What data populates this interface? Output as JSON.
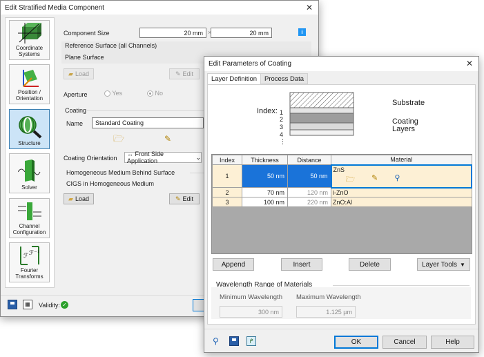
{
  "back_window": {
    "title": "Edit Stratified Media Component",
    "sidebar": [
      {
        "label": "Coordinate Systems"
      },
      {
        "label": "Position / Orientation"
      },
      {
        "label": "Structure"
      },
      {
        "label": "Solver"
      },
      {
        "label": "Channel Configuration"
      },
      {
        "label": "Fourier Transforms"
      }
    ],
    "component_size_label": "Component Size",
    "size_x": "20 mm",
    "size_times": "×",
    "size_y": "20 mm",
    "reference_surface_title": "Reference Surface (all Channels)",
    "reference_surface_value": "Plane Surface",
    "load_label": "Load",
    "edit_label": "Edit",
    "aperture_label": "Aperture",
    "aperture_yes": "Yes",
    "aperture_no": "No",
    "coating_title": "Coating",
    "name_label": "Name",
    "coating_name": "Standard Coating",
    "coating_orientation_label": "Coating Orientation",
    "coating_orientation_value": "↔ Front Side Application",
    "homogeneous_title": "Homogeneous Medium Behind Surface",
    "homogeneous_value": "CIGS in Homogeneous Medium",
    "load2_label": "Load",
    "edit2_label": "Edit",
    "validity_label": "Validity:",
    "info_icon_text": "i"
  },
  "front_window": {
    "title": "Edit Parameters of Coating",
    "tabs": [
      {
        "label": "Layer Definition"
      },
      {
        "label": "Process Data"
      }
    ],
    "diagram": {
      "index_label": "Index:",
      "indices": [
        "1",
        "2",
        "3",
        "4",
        "⋮"
      ],
      "substrate_label": "Substrate",
      "coating_layers_label": "Coating\nLayers"
    },
    "table": {
      "headers": [
        "Index",
        "Thickness",
        "Distance",
        "Material"
      ],
      "rows": [
        {
          "index": "1",
          "thickness": "50 nm",
          "distance": "50 nm",
          "material": "ZnS"
        },
        {
          "index": "2",
          "thickness": "70 nm",
          "distance": "120 nm",
          "material": "i-ZnO"
        },
        {
          "index": "3",
          "thickness": "100 nm",
          "distance": "220 nm",
          "material": "ZnO:Al"
        }
      ]
    },
    "buttons": {
      "append": "Append",
      "insert": "Insert",
      "delete": "Delete",
      "layer_tools": "Layer Tools"
    },
    "wavelength_title": "Wavelength Range of Materials",
    "min_wavelength_label": "Minimum Wavelength",
    "max_wavelength_label": "Maximum Wavelength",
    "min_wavelength": "300 nm",
    "max_wavelength": "1.125 µm",
    "ok": "OK",
    "cancel": "Cancel",
    "help": "Help"
  },
  "colors": {
    "accent": "#0078d7",
    "selection": "#1a73d9",
    "row_highlight": "#fdf0d5",
    "info_blue": "#2196f3",
    "validity_green": "#2ca02c"
  }
}
